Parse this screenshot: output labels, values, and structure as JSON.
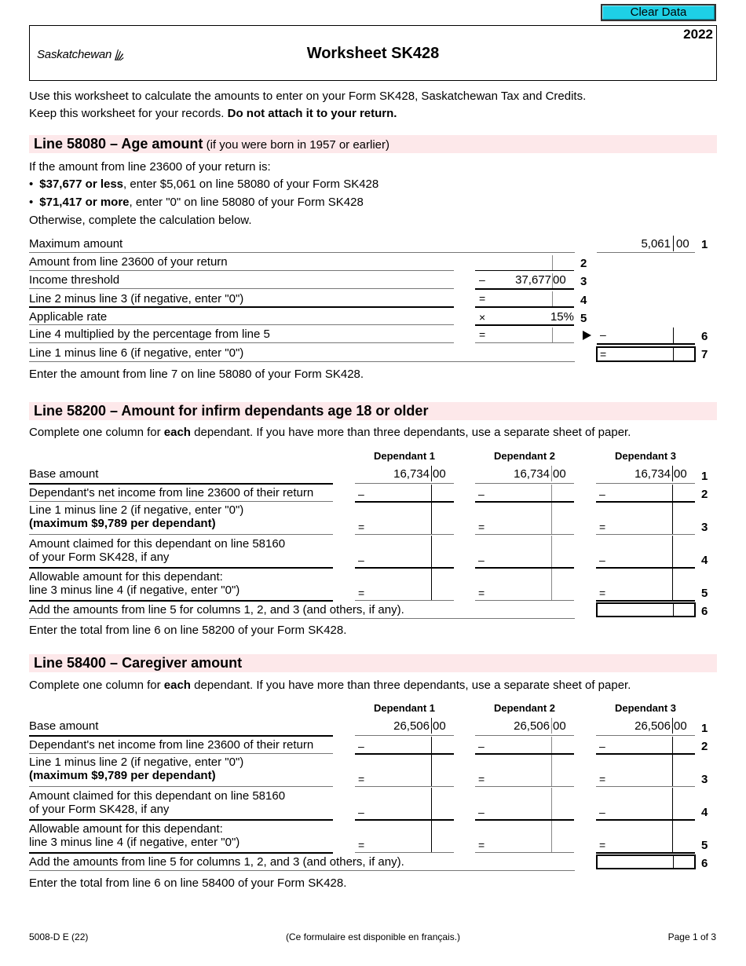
{
  "toolbar": {
    "clear_label": "Clear Data"
  },
  "header": {
    "logo_text": "Saskatchewan",
    "title": "Worksheet SK428",
    "year": "2022"
  },
  "intro": {
    "line1": "Use this worksheet to calculate the amounts to enter on your Form SK428, Saskatchewan Tax and Credits.",
    "line2_normal": "Keep this worksheet for your records. ",
    "line2_bold": "Do not attach it to your return."
  },
  "age_section": {
    "title": "Line 58080 – Age amount",
    "subtitle": " (if you were born in 1957 or earlier)",
    "condition_intro": "If the amount from line 23600 of your return is:",
    "bullets": [
      {
        "bold": "$37,677 or less",
        "text": ", enter $5,061 on line 58080 of your Form SK428"
      },
      {
        "bold": "$71,417 or more",
        "text": ", enter \"0\" on line 58080 of your Form SK428"
      }
    ],
    "otherwise": "Otherwise, complete the calculation below.",
    "rows": [
      {
        "label": "Maximum amount",
        "line": "1",
        "dollars": "5,061",
        "cents": "00"
      },
      {
        "label": "Amount from line 23600 of your return",
        "line": "2",
        "dollars": "",
        "cents": ""
      },
      {
        "label": "Income threshold",
        "line": "3",
        "op": "–",
        "dollars": "37,677",
        "cents": "00"
      },
      {
        "label": "Line 2 minus line 3 (if negative, enter \"0\")",
        "line": "4",
        "op": "=",
        "dollars": "",
        "cents": ""
      },
      {
        "label": "Applicable rate",
        "line": "5",
        "op": "×",
        "value": "15%"
      },
      {
        "label": "Line 4 multiplied by the percentage from line 5",
        "line": "6",
        "op": "=",
        "right_op": "–",
        "dollars": "",
        "cents": ""
      },
      {
        "label": "Line 1 minus line 6 (if negative, enter \"0\")",
        "line": "7",
        "op": "=",
        "dollars": "",
        "cents": ""
      }
    ],
    "footer_note": "Enter the amount from line 7 on line 58080 of your Form SK428."
  },
  "infirm_section": {
    "title": "Line 58200 – Amount for infirm dependants age 18 or older",
    "instr_pre": "Complete one column for ",
    "instr_bold": "each",
    "instr_post": " dependant. If you have more than three dependants, use a separate sheet of paper.",
    "columns": [
      "Dependant 1",
      "Dependant 2",
      "Dependant 3"
    ],
    "rows": [
      {
        "line": "1",
        "label1": "Base amount",
        "label2": "",
        "op": "",
        "values": [
          "16,734",
          "16,734",
          "16,734"
        ],
        "cents": "00"
      },
      {
        "line": "2",
        "label1": "Dependant's net income from line 23600 of their return",
        "label2": "",
        "op": "–"
      },
      {
        "line": "3",
        "label1": "Line 1 minus line 2 (if negative, enter \"0\")",
        "label2": "(maximum $9,789 per dependant)",
        "op": "="
      },
      {
        "line": "4",
        "label1": "Amount claimed for this dependant on line 58160",
        "label2": "of your Form SK428, if any",
        "op": "–"
      },
      {
        "line": "5",
        "label1": "Allowable amount for this dependant:",
        "label2": "line 3 minus line 4 (if negative, enter \"0\")",
        "op": "="
      },
      {
        "line": "6",
        "label1": "Add the amounts from line 5 for columns 1, 2, and 3 (and others, if any)."
      }
    ],
    "footer_note": "Enter the total from line 6 on line 58200 of your Form SK428."
  },
  "caregiver_section": {
    "title": "Line 58400 – Caregiver amount",
    "instr_pre": "Complete one column for ",
    "instr_bold": "each",
    "instr_post": " dependant. If you have more than three dependants, use a separate sheet of paper.",
    "columns": [
      "Dependant 1",
      "Dependant 2",
      "Dependant 3"
    ],
    "rows": [
      {
        "line": "1",
        "label1": "Base amount",
        "label2": "",
        "op": "",
        "values": [
          "26,506",
          "26,506",
          "26,506"
        ],
        "cents": "00"
      },
      {
        "line": "2",
        "label1": "Dependant's net income from line 23600 of their return",
        "label2": "",
        "op": "–"
      },
      {
        "line": "3",
        "label1": "Line 1 minus line 2 (if negative, enter \"0\")",
        "label2": "(maximum $9,789 per dependant)",
        "op": "="
      },
      {
        "line": "4",
        "label1": "Amount claimed for this dependant on line 58160",
        "label2": "of your Form SK428, if any",
        "op": "–"
      },
      {
        "line": "5",
        "label1": "Allowable amount for this dependant:",
        "label2": "line 3 minus line 4 (if negative, enter \"0\")",
        "op": "="
      },
      {
        "line": "6",
        "label1": "Add the amounts from line 5 for columns 1, 2, and 3 (and others, if any)."
      }
    ],
    "footer_note": "Enter the total from line 6 on line 58400 of your Form SK428."
  },
  "footer": {
    "form_code": "5008-D E (22)",
    "french_note": "(Ce formulaire est disponible en français.)",
    "page": "Page 1 of 3"
  },
  "icons": {
    "arrow": "right-triangle-arrow",
    "logo_mark": "wheat-sheaf-logo"
  },
  "colors": {
    "button_bg": "#1ed0e6",
    "section_band": "#fde8ea"
  }
}
